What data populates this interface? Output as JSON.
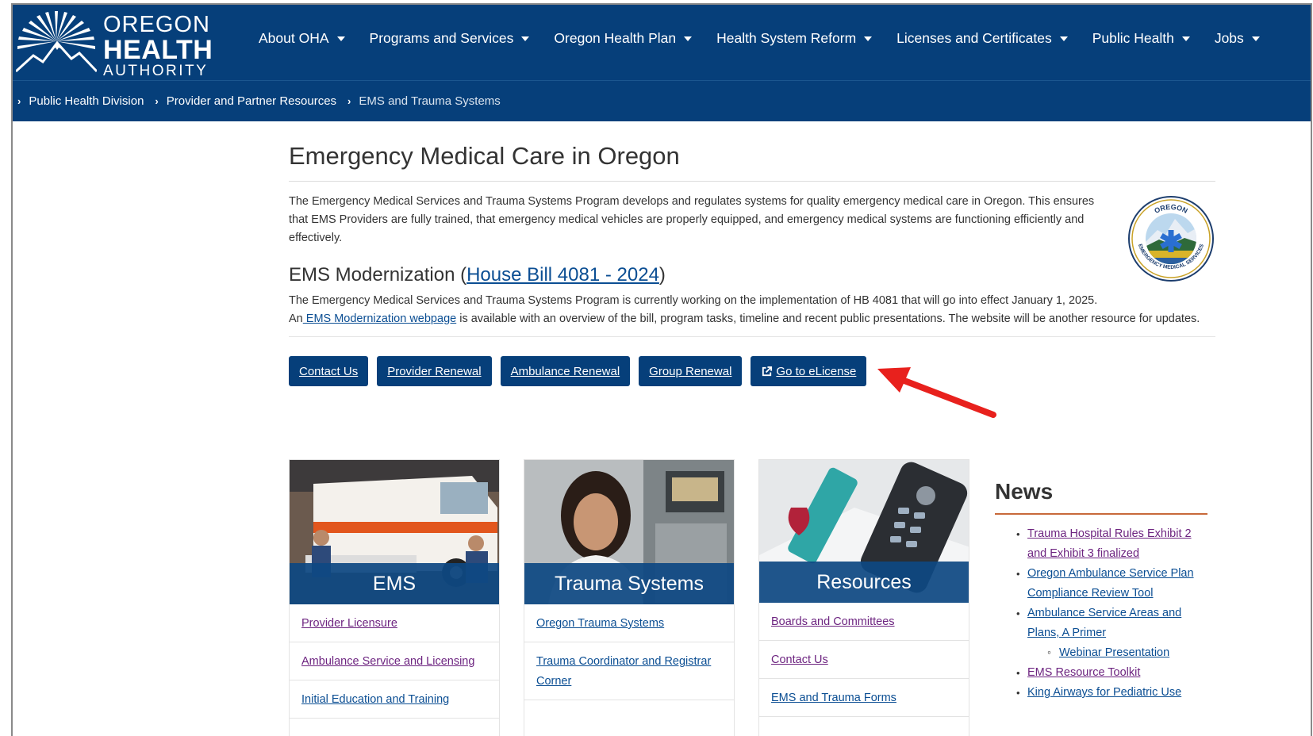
{
  "header": {
    "logo": {
      "line1": "OREGON",
      "line2": "HEALTH",
      "line3": "AUTHORITY"
    },
    "nav": [
      {
        "label": "About OHA"
      },
      {
        "label": "Programs and Services"
      },
      {
        "label": "Oregon Health Plan"
      },
      {
        "label": "Health System Reform"
      },
      {
        "label": "Licenses and Certificates"
      },
      {
        "label": "Public Health"
      },
      {
        "label": "Jobs"
      }
    ]
  },
  "breadcrumb": {
    "items": [
      "Public Health Division",
      "Provider and Partner Resources"
    ],
    "current": "EMS and Trauma Systems"
  },
  "main": {
    "title": "Emergency Medical Care in Oregon",
    "intro": "The Emergency Medical Services and Trauma Systems Program develops and regulates systems for quality emergency medical care in Oregon. This ensures that EMS Providers are fully trained, that emergency medical vehicles are properly equipped, and emergency medical systems are functioning efficiently and effectively.",
    "seal": {
      "top_text": "OREGON",
      "bottom_text": "EMERGENCY MEDICAL SERVICES"
    },
    "modernization": {
      "heading_prefix": "EMS Modernization (",
      "heading_link": "House Bill 4081 - 2024",
      "heading_suffix": ")",
      "line1": "The Emergency Medical Services and Trauma Systems Program is currently working on the implementation of HB 4081 that will go into effect January 1, 2025.",
      "line2_prefix": "An",
      "line2_link": " EMS Modernization webpage",
      "line2_suffix": " is available with an overview of the bill, program tasks, timeline and recent public presentations. The website will be another resource for updates."
    },
    "buttons": {
      "contact": "Contact Us",
      "provider_renewal": "Provider Renewal",
      "ambulance_renewal": "Ambulance Renewal",
      "group_renewal": "Group Renewal",
      "elicense": " Go to eLicense"
    },
    "accent_color": "#063f7a",
    "annotation_color": "#e8211d"
  },
  "cards": [
    {
      "title": "EMS",
      "links": [
        "Provider Licensure",
        "Ambulance Service and Licensing",
        "Initial Education and Training"
      ]
    },
    {
      "title": "Trauma Systems",
      "links": [
        "Oregon Trauma Systems",
        "Trauma Coordinator and Registrar Corner"
      ]
    },
    {
      "title": "Resources",
      "links": [
        "Boards and Committees",
        "Contact Us",
        "EMS and Trauma Forms"
      ]
    }
  ],
  "news": {
    "title": "News",
    "items": [
      "Trauma Hospital Rules Exhibit 2 and Exhibit 3 finalized",
      "Oregon Ambulance Service Plan Compliance Review Tool",
      "Ambulance Service Areas and Plans, A Primer",
      "Webinar Presentation",
      "EMS Resource Toolkit",
      "King Airways for Pediatric Use"
    ]
  }
}
